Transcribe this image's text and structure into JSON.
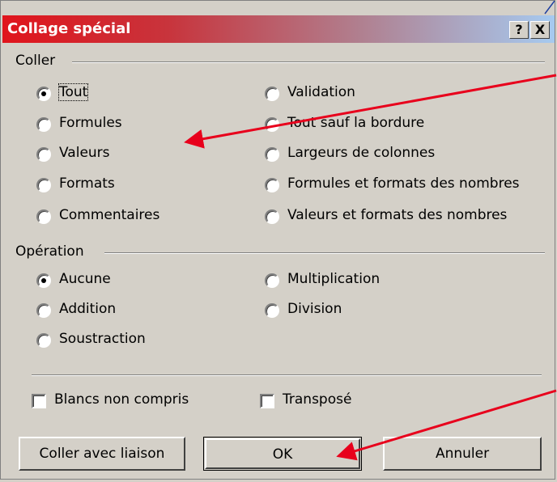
{
  "window": {
    "title": "Collage spécial",
    "help_button": "?",
    "close_button": "X"
  },
  "paste_group": {
    "label": "Coller",
    "options": [
      {
        "label": "Tout",
        "checked": true
      },
      {
        "label": "Formules",
        "checked": false
      },
      {
        "label": "Valeurs",
        "checked": false
      },
      {
        "label": "Formats",
        "checked": false
      },
      {
        "label": "Commentaires",
        "checked": false
      },
      {
        "label": "Validation",
        "checked": false
      },
      {
        "label": "Tout sauf la bordure",
        "checked": false
      },
      {
        "label": "Largeurs de colonnes",
        "checked": false
      },
      {
        "label": "Formules et formats des nombres",
        "checked": false
      },
      {
        "label": "Valeurs et formats des nombres",
        "checked": false
      }
    ]
  },
  "operation_group": {
    "label": "Opération",
    "options": [
      {
        "label": "Aucune",
        "checked": true
      },
      {
        "label": "Addition",
        "checked": false
      },
      {
        "label": "Soustraction",
        "checked": false
      },
      {
        "label": "Multiplication",
        "checked": false
      },
      {
        "label": "Division",
        "checked": false
      }
    ]
  },
  "checkboxes": {
    "skip_blanks": "Blancs non compris",
    "transpose": "Transposé"
  },
  "buttons": {
    "paste_link": "Coller avec liaison",
    "ok": "OK",
    "cancel": "Annuler"
  },
  "colors": {
    "annotation_arrow": "#e8001c",
    "title_gradient_start": "#e0141c",
    "title_gradient_end": "#a6caf0"
  }
}
